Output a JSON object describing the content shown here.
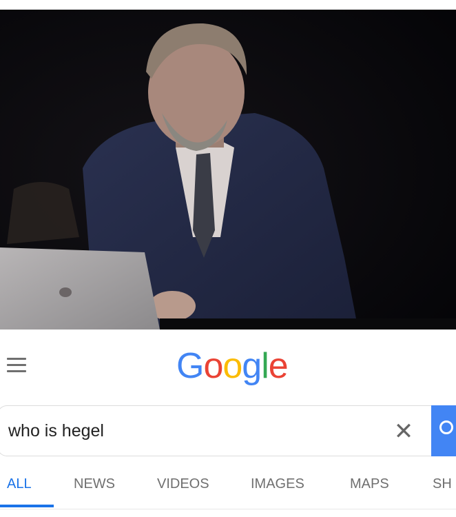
{
  "photo": {
    "alt": "man typing on laptop"
  },
  "header": {
    "logo_letters": [
      {
        "ch": "G",
        "color": "#4285f4"
      },
      {
        "ch": "o",
        "color": "#ea4335"
      },
      {
        "ch": "o",
        "color": "#fbbc05"
      },
      {
        "ch": "g",
        "color": "#4285f4"
      },
      {
        "ch": "l",
        "color": "#34a853"
      },
      {
        "ch": "e",
        "color": "#ea4335"
      }
    ]
  },
  "search": {
    "query": "who is hegel",
    "clear_glyph": "✕"
  },
  "tabs": [
    {
      "label": "ALL",
      "active": true
    },
    {
      "label": "NEWS",
      "active": false
    },
    {
      "label": "VIDEOS",
      "active": false
    },
    {
      "label": "IMAGES",
      "active": false
    },
    {
      "label": "MAPS",
      "active": false
    },
    {
      "label": "SH",
      "active": false
    }
  ],
  "colors": {
    "accent": "#1a73e8",
    "search_button": "#4285f4"
  }
}
